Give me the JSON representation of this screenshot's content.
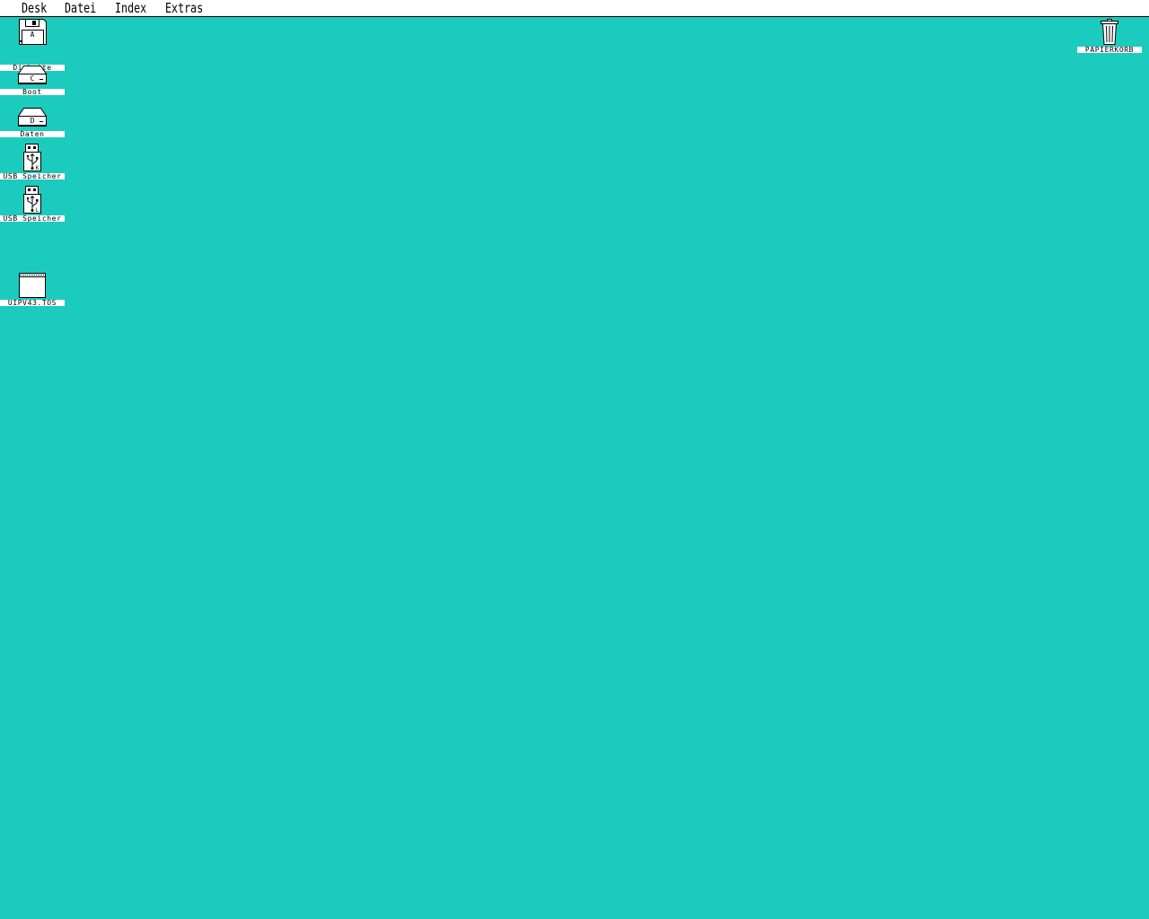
{
  "menubar": {
    "items": [
      {
        "label": "Desk"
      },
      {
        "label": "Datei"
      },
      {
        "label": "Index"
      },
      {
        "label": "Extras"
      }
    ]
  },
  "desktop": {
    "background_color": "#1bcbbd",
    "icons": [
      {
        "label": "Diskette",
        "icon": "floppy-icon",
        "drive_letter": "A"
      },
      {
        "label": "Boot",
        "icon": "hard-drive-icon",
        "drive_letter": "C"
      },
      {
        "label": "Daten",
        "icon": "hard-drive-icon",
        "drive_letter": "D"
      },
      {
        "label": "USB Speicher",
        "icon": "usb-stick-icon",
        "drive_letter": "K"
      },
      {
        "label": "USB Speicher",
        "icon": "usb-stick-icon",
        "drive_letter": "L"
      },
      {
        "label": "UIPV43.TOS",
        "icon": "program-icon"
      },
      {
        "label": "PAPIERKORB",
        "icon": "trash-icon"
      }
    ]
  }
}
